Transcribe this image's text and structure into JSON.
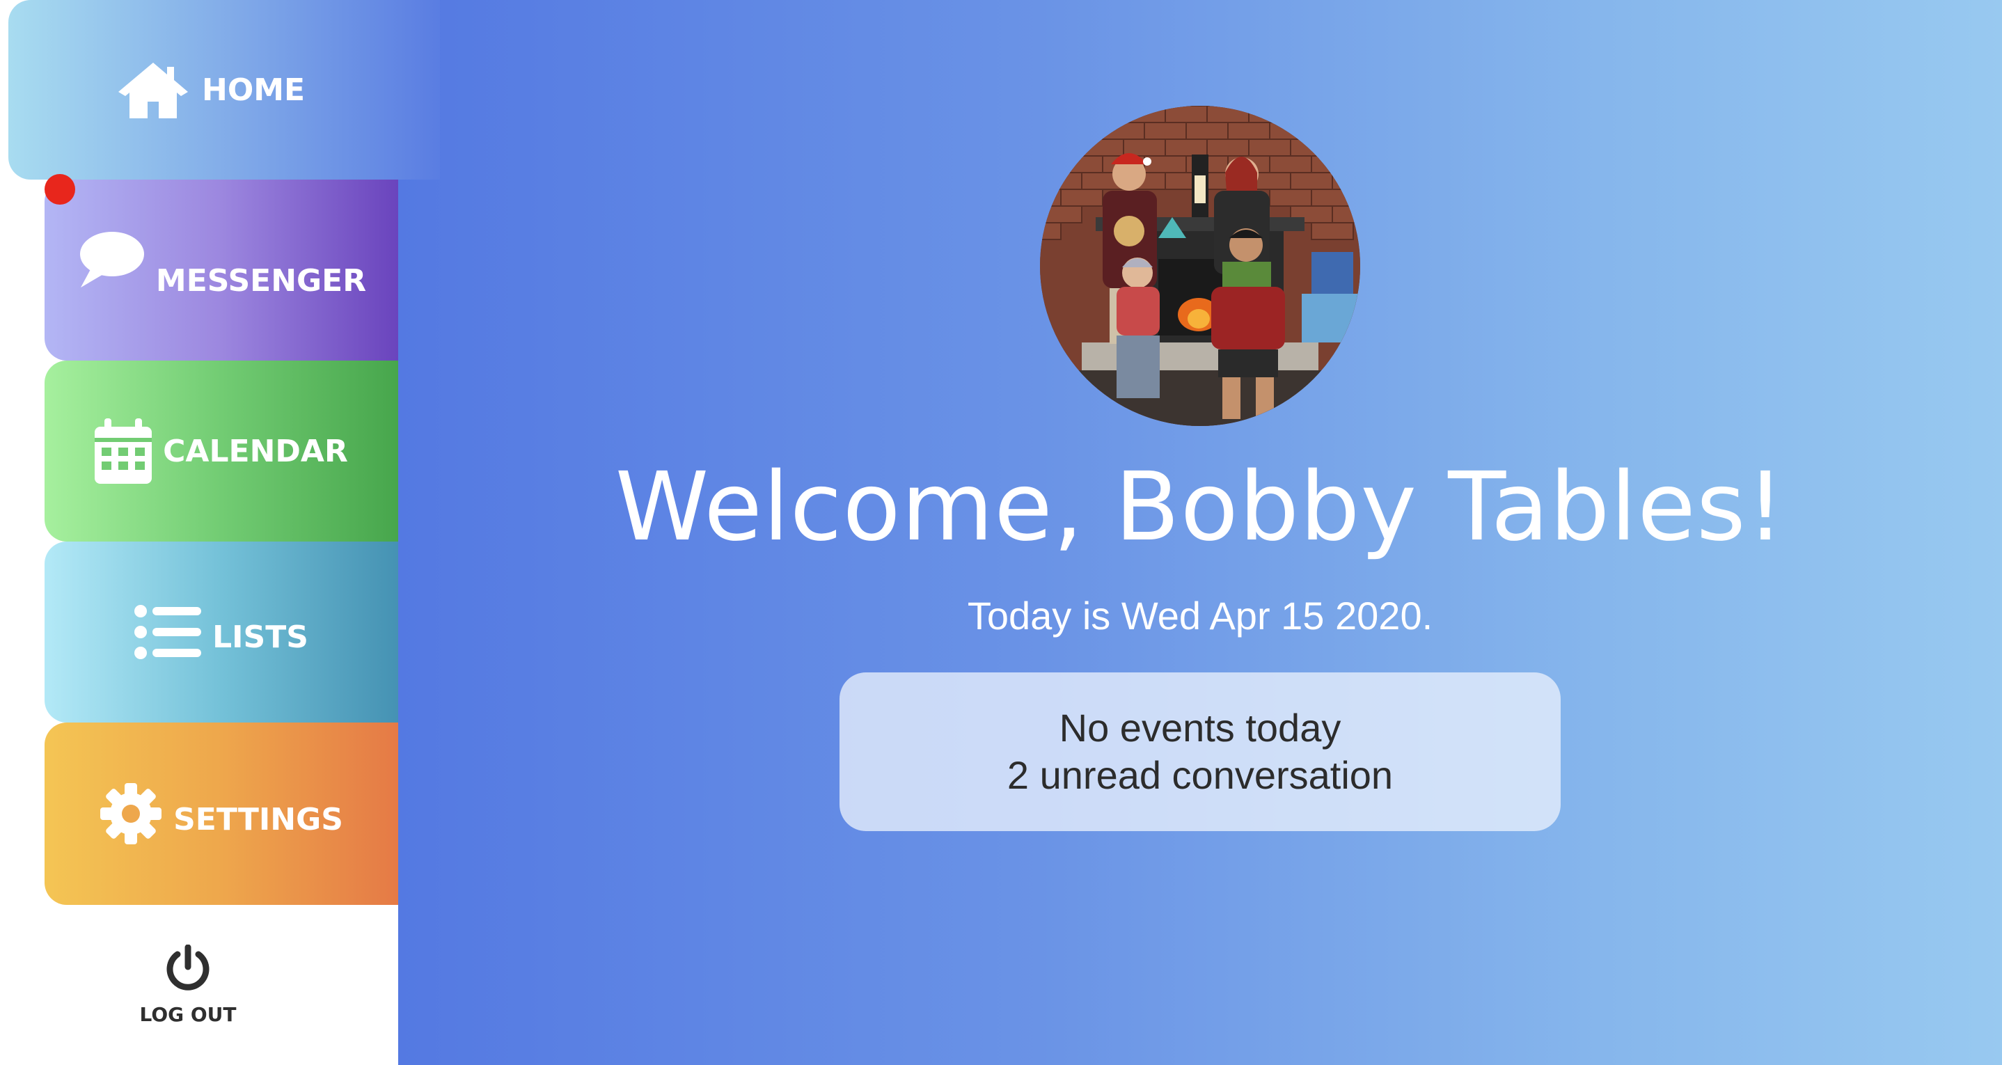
{
  "sidebar": {
    "items": [
      {
        "label": "HOME",
        "icon": "home-icon"
      },
      {
        "label": "MESSENGER",
        "icon": "chat-bubble-icon",
        "has_notification": true
      },
      {
        "label": "CALENDAR",
        "icon": "calendar-icon"
      },
      {
        "label": "LISTS",
        "icon": "list-icon"
      },
      {
        "label": "SETTINGS",
        "icon": "gear-icon"
      }
    ],
    "logout_label": "LOG OUT",
    "logout_icon": "power-icon"
  },
  "main": {
    "welcome": "Welcome, Bobby Tables!",
    "today": "Today is Wed Apr 15 2020.",
    "summary": {
      "events": "No events today",
      "conversations": "2 unread conversation"
    }
  },
  "colors": {
    "notification": "#e8261c",
    "home": "#7fa8e8",
    "messenger": "#9c87df",
    "calendar": "#72cc73",
    "lists": "#74c1d8",
    "settings": "#eea74c"
  }
}
